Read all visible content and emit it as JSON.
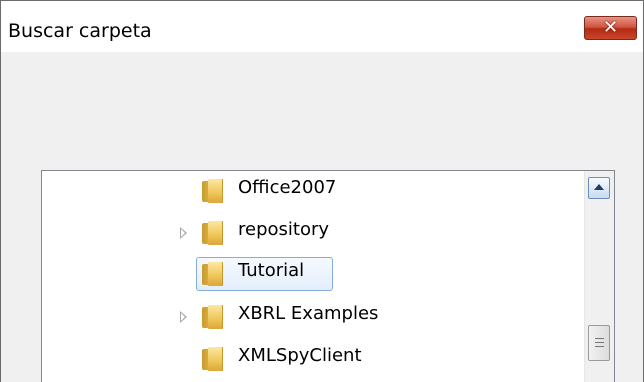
{
  "dialog": {
    "title": "Buscar carpeta",
    "close_label": "✕"
  },
  "tree": {
    "items": [
      {
        "label": "Office2007",
        "has_children": false,
        "selected": false
      },
      {
        "label": "repository",
        "has_children": true,
        "selected": false
      },
      {
        "label": "Tutorial",
        "has_children": false,
        "selected": true
      },
      {
        "label": "XBRL Examples",
        "has_children": true,
        "selected": false
      },
      {
        "label": "XMLSpyClient",
        "has_children": false,
        "selected": false
      }
    ]
  },
  "colors": {
    "close_button": "#c8462c",
    "selection_border": "#84acdd",
    "folder": "#f0c85c"
  },
  "icons": {
    "folder": "folder-icon",
    "expander": "expand-arrow-icon",
    "close": "close-icon",
    "scroll_up": "scroll-up-arrow-icon"
  }
}
